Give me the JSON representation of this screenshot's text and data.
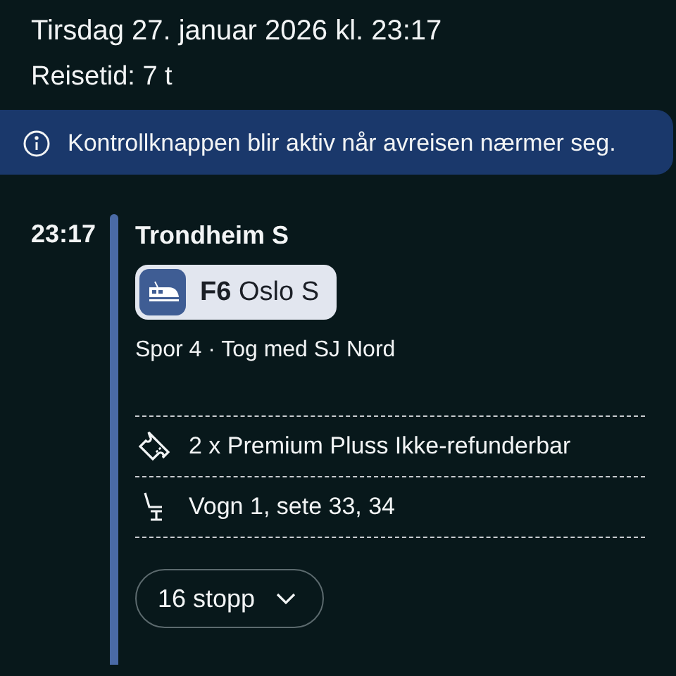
{
  "header": {
    "date": "Tirsdag 27. januar 2026 kl. 23:17",
    "duration": "Reisetid: 7 t"
  },
  "notice": {
    "text": "Kontrollknappen blir aktiv når avreisen nærmer seg."
  },
  "leg": {
    "time": "23:17",
    "station": "Trondheim S",
    "line": {
      "code": "F6",
      "destination": "Oslo S"
    },
    "platform": "Spor 4 · Tog med SJ Nord",
    "details": [
      {
        "kind": "ticket",
        "text": "2 x Premium Pluss Ikke-refunderbar"
      },
      {
        "kind": "seat",
        "text": "Vogn 1, sete 33, 34"
      }
    ],
    "stops_button": {
      "label": "16 stopp",
      "expanded": false
    }
  }
}
